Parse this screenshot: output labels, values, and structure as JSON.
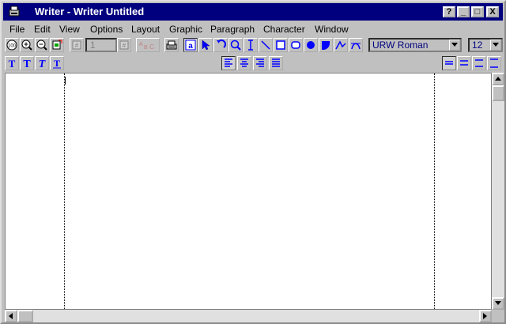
{
  "window": {
    "title": "Writer - Writer Untitled",
    "controls": {
      "help": "?",
      "minimize": "_",
      "maximize": "□",
      "close": "X"
    }
  },
  "menu": {
    "items": [
      {
        "label": "File"
      },
      {
        "label": "Edit"
      },
      {
        "label": "View"
      },
      {
        "label": "Options"
      },
      {
        "label": "Layout"
      },
      {
        "label": "Graphic"
      },
      {
        "label": "Paragraph"
      },
      {
        "label": "Character"
      },
      {
        "label": "Window"
      }
    ]
  },
  "toolbar": {
    "page_number": "1",
    "font_name": "URW Roman",
    "font_size": "12"
  },
  "colors": {
    "titlebar": "#00007f",
    "accent": "#0000ff",
    "face": "#c0c0c0"
  }
}
